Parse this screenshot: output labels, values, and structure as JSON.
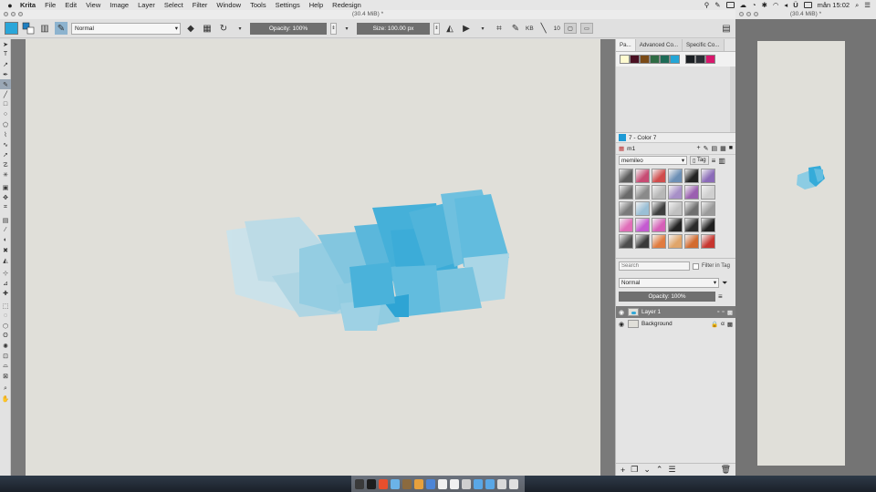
{
  "menubar": {
    "app": "Krita",
    "items": [
      "File",
      "Edit",
      "View",
      "Image",
      "Layer",
      "Select",
      "Filter",
      "Window",
      "Tools",
      "Settings",
      "Help",
      "Redesign"
    ],
    "lang": "Ü",
    "clock": "mån 15:02"
  },
  "window": {
    "title": "(30.4 MiB)",
    "title_mark": "*"
  },
  "toolbar": {
    "blend_mode": "Normal",
    "opacity_label": "Opacity: 100%",
    "size_label": "Size:",
    "size_value": "100.00 px",
    "kb_label": "KB",
    "flow_value": "10"
  },
  "palette": {
    "tabs": [
      "Pa...",
      "Advanced Co...",
      "Specific Co..."
    ],
    "swatches": [
      "#fffbd0",
      "#4a1022",
      "#7a4a17",
      "#2f6b44",
      "#1d6b57",
      "#24a6d6",
      "#1a1e22",
      "#2a2e34",
      "#d8176c"
    ],
    "selected_color_name": "7 - Color 7",
    "selected_color_hex": "#1d9ad5",
    "palette_name": "m1"
  },
  "presets": {
    "selected": "memileo",
    "tag_label": "Tag",
    "search_placeholder": "Search",
    "filter_label": "Filter in Tag",
    "tiles": [
      "#5b5b5b",
      "#c74b73",
      "#d04c4c",
      "#6c8fb5",
      "#222222",
      "#8b6bb8",
      "#6a6a6a",
      "#8a8a8a",
      "#b7b7b7",
      "#a78fc7",
      "#9b5fb0",
      "#cfcfcf",
      "#7a7a7a",
      "#9abfd6",
      "#3d3d3d",
      "#c0c0c0",
      "#6f6f6f",
      "#9a9a9a",
      "#e06db8",
      "#c45ad1",
      "#d65fb7",
      "#222222",
      "#2b2b2b",
      "#1f1f1f",
      "#4d4d4d",
      "#393939",
      "#e07b3f",
      "#e0a56a",
      "#d36b2f",
      "#c7362f"
    ]
  },
  "layers": {
    "blend_mode": "Normal",
    "opacity_label": "Opacity:  100%",
    "items": [
      {
        "name": "Layer 1",
        "active": true
      },
      {
        "name": "Background",
        "active": false
      }
    ]
  },
  "sidewin": {
    "title": "(30.4 MiB)",
    "title_mark": "*"
  },
  "dock_colors": [
    "#3a3a3a",
    "#1d1d1d",
    "#e94f2c",
    "#6bb3e8",
    "#8b6a3e",
    "#e7a03c",
    "#4d85d6",
    "#f0f0f0",
    "#f0f0f0",
    "#cfcfcf",
    "#59a7e6",
    "#59a7e6",
    "#d9d9d9",
    "#e0e0e0"
  ]
}
